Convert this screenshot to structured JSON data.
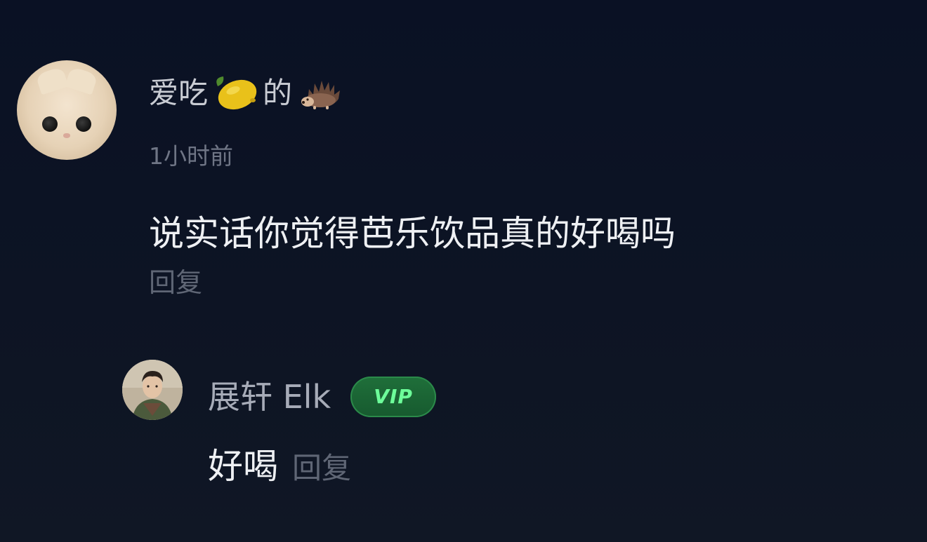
{
  "comment": {
    "username_prefix": "爱吃",
    "username_suffix": "的",
    "username_emojis": [
      "lemon-icon",
      "hedgehog-icon"
    ],
    "timestamp": "1小时前",
    "text": "说实话你觉得芭乐饮品真的好喝吗",
    "reply_label": "回复"
  },
  "reply": {
    "username": "展轩 Elk",
    "badge": "VIP",
    "text": "好喝",
    "reply_label": "回复"
  },
  "colors": {
    "background": "#0e1526",
    "primary_text": "#eef0f3",
    "username_text": "#c9ccd3",
    "muted_text": "#6f7585",
    "vip_green": "#6dff9a",
    "vip_bg": "#1f6f3a"
  }
}
